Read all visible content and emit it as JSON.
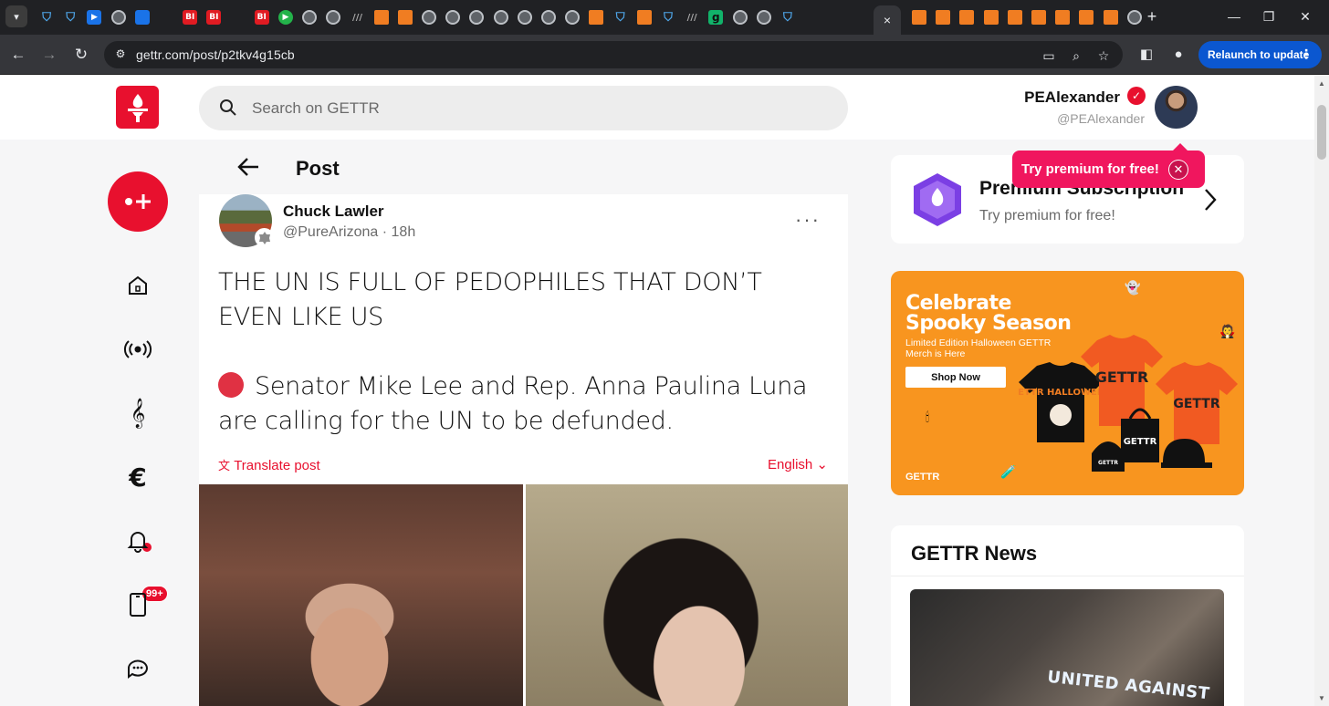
{
  "browser": {
    "tab_list_icon": "chevron-down-icon",
    "tab_favicons": [
      "shield",
      "shield",
      "arrow",
      "globe",
      "blue-shield",
      "search",
      "bi",
      "bi",
      "search",
      "bi",
      "play",
      "globe",
      "globe",
      "ll",
      "flag",
      "flag",
      "globe",
      "globe",
      "globe",
      "globe",
      "globe",
      "globe",
      "globe",
      "flag",
      "shield",
      "flag",
      "shield",
      "ll",
      "g",
      "globe",
      "globe",
      "shield"
    ],
    "active_tab_close": "×",
    "trailing_tab_favicons": [
      "flag",
      "flag",
      "flag",
      "flag",
      "flag",
      "flag",
      "flag",
      "flag",
      "flag",
      "globe"
    ],
    "new_tab_label": "+",
    "url": "gettr.com/post/p2tkv4g15cb",
    "relaunch_label": "Relaunch to update",
    "relaunch_menu": "⋮"
  },
  "header": {
    "search_placeholder": "Search on GETTR",
    "user_display_name": "PEAlexander",
    "user_handle": "@PEAlexander"
  },
  "nav": {
    "notifications_badge": "99+",
    "items": [
      "home",
      "live",
      "music",
      "earn",
      "notifications",
      "clips",
      "chat"
    ]
  },
  "post": {
    "page_title": "Post",
    "author_name": "Chuck Lawler",
    "author_handle": "@PureArizona",
    "time": "18h",
    "meta_separator": "·",
    "more_label": "···",
    "text_line1": "THE UN IS FULL OF PEDOPHILES THAT DON’T EVEN LIKE US",
    "text_line2": "Senator Mike Lee and Rep. Anna Paulina Luna are calling for the UN to be defunded.",
    "translate_label": "Translate post",
    "language_label": "English"
  },
  "sidebar": {
    "premium_title": "Premium Subscription",
    "premium_subtitle": "Try premium for free!",
    "tooltip_text": "Try premium for free!",
    "ad": {
      "title": "Celebrate Spooky Season",
      "subtitle": "Limited Edition Halloween GETTR Merch is Here",
      "button": "Shop Now",
      "brand": "GETTR",
      "shirt1_text": "GETTR HALLOWEEN",
      "shirt2_text": "GETTR",
      "shirt3_text": "GETTR",
      "tote_text": "GETTR",
      "hat_text": "GETTR"
    },
    "news_title": "GETTR News",
    "news_image_text": "UNITED AGAINST"
  },
  "colors": {
    "brand_red": "#e8102e",
    "tooltip_pink": "#f0165e",
    "ad_orange": "#f8951f",
    "relaunch_blue": "#0b57d0"
  }
}
